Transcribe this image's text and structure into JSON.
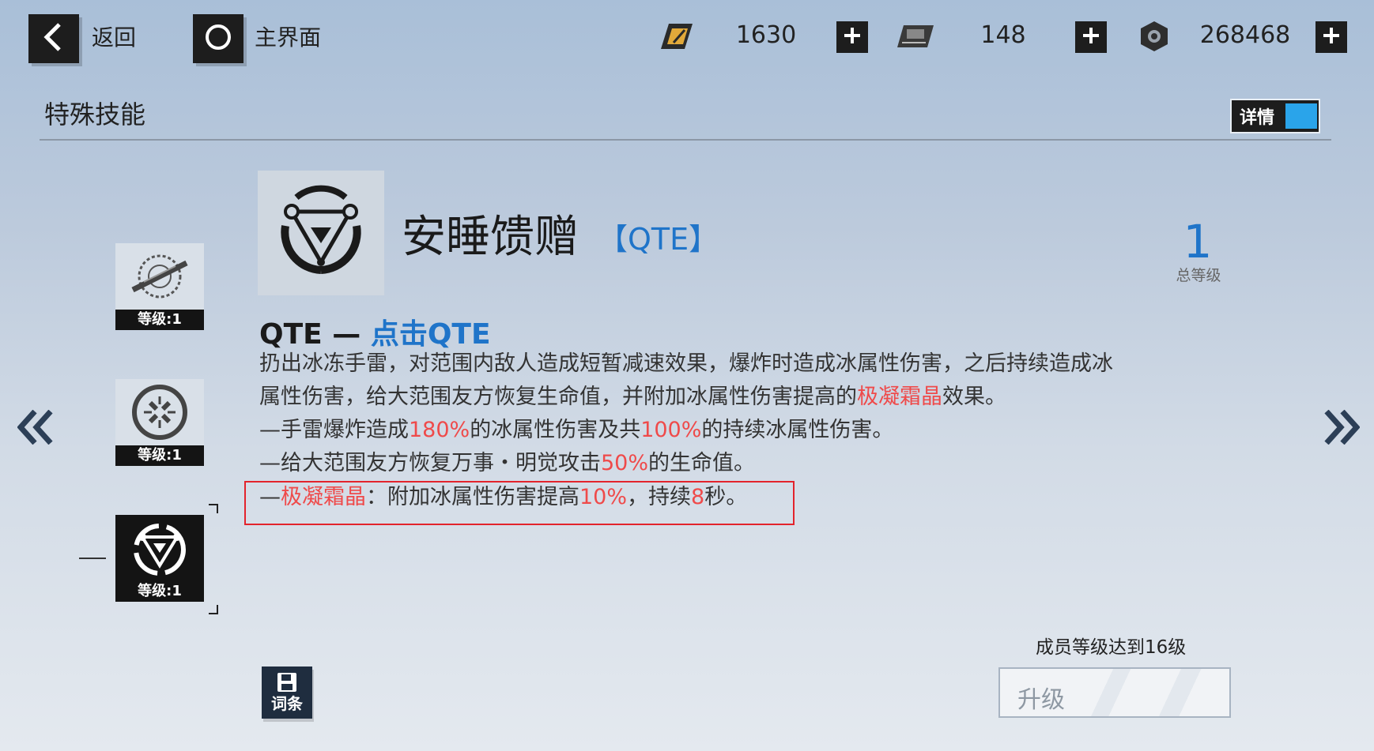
{
  "topbar": {
    "back_label": "返回",
    "home_label": "主界面",
    "resources": [
      {
        "icon": "gold-ticket-icon",
        "value": "1630"
      },
      {
        "icon": "chip-card-icon",
        "value": "148"
      },
      {
        "icon": "hex-nut-icon",
        "value": "268468"
      }
    ]
  },
  "section": {
    "title": "特殊技能",
    "detail_toggle_label": "详情"
  },
  "skill_list": [
    {
      "icon": "rifle-crosshair-icon",
      "level": "等级:1"
    },
    {
      "icon": "target-reticle-icon",
      "level": "等级:1"
    },
    {
      "icon": "triangle-grenade-icon",
      "level": "等级:1",
      "selected": true
    }
  ],
  "skill": {
    "name": "安睡馈赠",
    "tag": "【QTE】",
    "total_level": "1",
    "total_level_label": "总等级",
    "qte_head_prefix": "QTE — ",
    "qte_head_action": "点击QTE",
    "desc": {
      "line1": "扔出冰冻手雷，对范围内敌人造成短暂减速效果，爆炸时造成冰属性伤害，之后持续造成冰",
      "line2_a": "属性伤害，给大范围友方恢复生命值，并附加冰属性伤害提高的",
      "line2_red": "极凝霜晶",
      "line2_b": "效果。",
      "line3_a": "—手雷爆炸造成",
      "line3_r1": "180%",
      "line3_b": "的冰属性伤害及共",
      "line3_r2": "100%",
      "line3_c": "的持续冰属性伤害。",
      "line4_a": "—给大范围友方恢复万事・明觉攻击",
      "line4_r": "50%",
      "line4_b": "的生命值。",
      "line5_a": "—",
      "line5_r1": "极凝霜晶",
      "line5_b": "：附加冰属性伤害提高",
      "line5_r2": "10%",
      "line5_c": "，持续",
      "line5_r3": "8",
      "line5_d": "秒。"
    }
  },
  "upgrade": {
    "requirement": "成员等级达到16级",
    "button_label": "升级"
  },
  "entry_button_label": "词条"
}
